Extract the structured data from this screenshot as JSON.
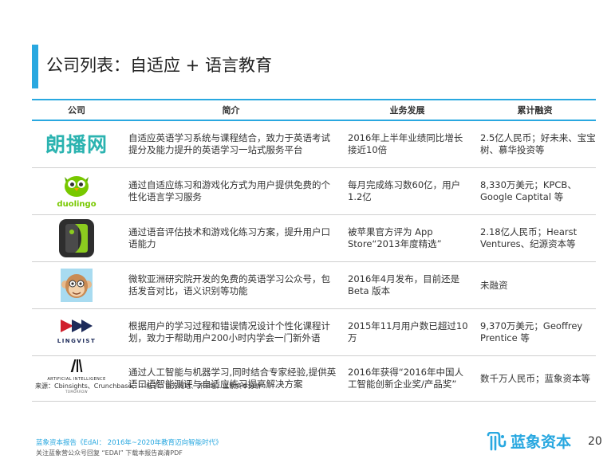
{
  "title": "公司列表：自适应 + 语言教育",
  "table": {
    "headers": [
      "公司",
      "简介",
      "业务发展",
      "累计融资"
    ],
    "rows": [
      {
        "logo": "langbo-logo",
        "logo_text": "朗播网",
        "intro": "自适应英语学习系统与课程结合，致力于英语考试提分及能力提升的英语学习一站式服务平台",
        "progress": "2016年上半年业绩同比增长接近10倍",
        "funding": "2.5亿人民币；好未来、宝宝树、慕华投资等"
      },
      {
        "logo": "duolingo-logo",
        "logo_text": "duolingo",
        "intro": "通过自适应练习和游戏化方式为用户提供免费的个性化语言学习服务",
        "progress": "每月完成练习数60亿，用户1.2亿",
        "funding": "8,330万美元；KPCB、Google Captital 等"
      },
      {
        "logo": "speech-app-logo",
        "logo_text": "",
        "intro": "通过语音评估技术和游戏化练习方案，提升用户口语能力",
        "progress": "被苹果官方评为 App Store“2013年度精选”",
        "funding": "2.18亿人民币；Hearst Ventures、纪源资本等"
      },
      {
        "logo": "monkey-avatar-logo",
        "logo_text": "",
        "intro": "微软亚洲研究院开发的免费的英语学习公众号，包括发音对比，语义识别等功能",
        "progress": "2016年4月发布，目前还是Beta 版本",
        "funding": "未融资"
      },
      {
        "logo": "lingvist-logo",
        "logo_text": "LINGVIST",
        "intro": "根据用户的学习过程和错误情况设计个性化课程计划，致力于帮助用户200小时内学会一门新外语",
        "progress": "2015年11月用户数已超过10万",
        "funding": "9,370万美元；Geoffrey Prentice 等"
      },
      {
        "logo": "ai-tomorrow-logo",
        "logo_text": "ARTIFICIAL INTELLIGENCE",
        "logo_sub": "TOMORROW",
        "intro": "通过人工智能与机器学习,同时结合专家经验,提供英语口语智能测评与自适应练习提高解决方案",
        "progress": "2016年获得“2016年中国人工智能创新企业奖/产品奖”",
        "funding": "数千万人民币；蓝象资本等"
      }
    ]
  },
  "source": "来源：Cbinsights、Crunchbase、IT 桔子、官方网站、芥末堆，蓝象资本分析",
  "footer": {
    "report": "蓝象资本报告《EdAI： 2016年~2020年教育迈向智能时代》",
    "note": "关注蓝象营公众号回复 “EDAI” 下载本报告高清PDF",
    "brand": "蓝象资本",
    "page": "20"
  },
  "colors": {
    "accent": "#29a8e0",
    "langbo": "#2bb3b0",
    "duolingo_green": "#78c800",
    "lingvist_red": "#d0202d",
    "lingvist_navy": "#1d2b5a"
  }
}
